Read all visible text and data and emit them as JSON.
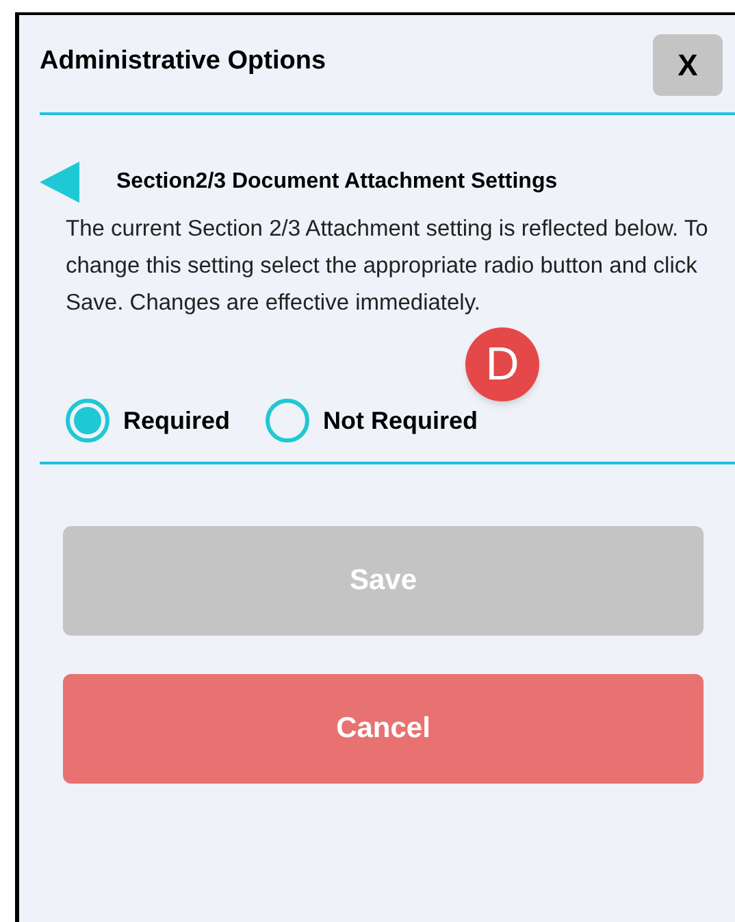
{
  "dialog": {
    "title": "Administrative Options",
    "close_label": "X"
  },
  "section": {
    "heading": "Section2/3 Document Attachment Settings",
    "description": "The current Section 2/3 Attachment setting is reflected below. To change this setting select the appropriate radio button and click Save. Changes are effective immediately."
  },
  "marker": {
    "label": "D"
  },
  "options": [
    {
      "label": "Required",
      "selected": true
    },
    {
      "label": "Not Required",
      "selected": false
    }
  ],
  "buttons": [
    {
      "label": "Save",
      "kind": "primary",
      "disabled": true
    },
    {
      "label": "Cancel",
      "kind": "cancel",
      "disabled": false
    }
  ]
}
